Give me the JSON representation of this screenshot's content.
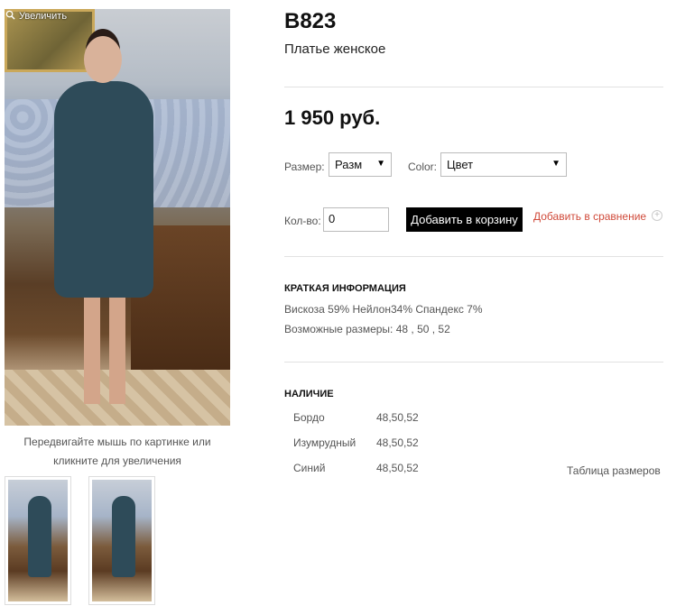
{
  "gallery": {
    "zoom_label": "Увеличить",
    "hint": "Передвигайте мышь по картинке или кликните для увеличения"
  },
  "product": {
    "sku": "B823",
    "subtitle": "Платье женское",
    "price": "1 950 руб."
  },
  "options": {
    "size_label": "Размер:",
    "size_value": "Разм",
    "color_label": "Color:",
    "color_value": "Цвет",
    "qty_label": "Кол-во:",
    "qty_value": "0",
    "add_to_cart": "Добавить в корзину",
    "add_to_compare": "Добавить в сравнение"
  },
  "brief": {
    "heading": "КРАТКАЯ ИНФОРМАЦИЯ",
    "composition": "Вискоза 59% Нейлон34% Спандекс 7%",
    "sizes": "Возможные размеры: 48 , 50 , 52"
  },
  "availability": {
    "heading": "НАЛИЧИЕ",
    "rows": [
      {
        "color": "Бордо",
        "sizes": "48,50,52"
      },
      {
        "color": "Изумрудный",
        "sizes": "48,50,52"
      },
      {
        "color": "Синий",
        "sizes": "48,50,52"
      }
    ],
    "size_table_link": "Таблица размеров"
  }
}
